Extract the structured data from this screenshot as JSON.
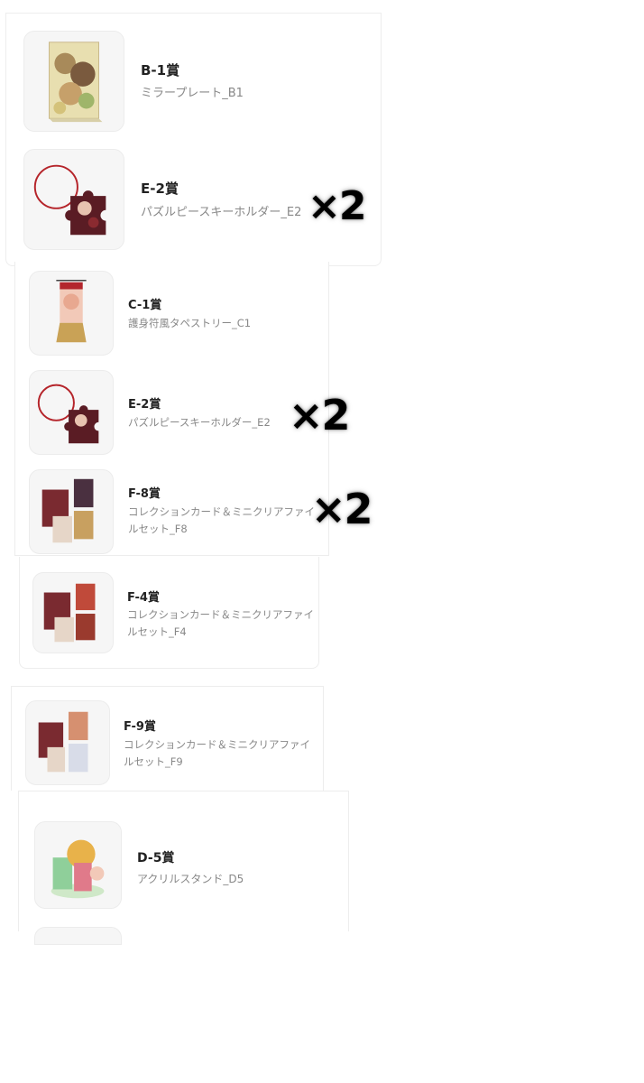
{
  "screenshots": [
    {
      "items": [
        {
          "title": "B-1賞",
          "subtitle": "ミラープレート_B1",
          "image": "mirror-plate-image"
        },
        {
          "title": "E-2賞",
          "subtitle": "パズルピースキーホルダー_E2",
          "image": "puzzle-keychain-image",
          "multiplier": "×2"
        }
      ]
    },
    {
      "items": [
        {
          "title": "C-1賞",
          "subtitle": "護身符風タペストリー_C1",
          "image": "tapestry-image"
        },
        {
          "title": "E-2賞",
          "subtitle": "パズルピースキーホルダー_E2",
          "image": "puzzle-keychain-image",
          "multiplier": "×2"
        },
        {
          "title": "F-8賞",
          "subtitle_line1": "コレクションカード＆ミニクリアファイ",
          "subtitle_line2": "ルセット_F8",
          "image": "card-file-set-image",
          "multiplier": "×2"
        }
      ]
    },
    {
      "items": [
        {
          "title": "F-4賞",
          "subtitle_line1": "コレクションカード＆ミニクリアファイ",
          "subtitle_line2": "ルセット_F4",
          "image": "card-file-set-image"
        }
      ]
    },
    {
      "items": [
        {
          "title": "F-9賞",
          "subtitle_line1": "コレクションカード＆ミニクリアファイ",
          "subtitle_line2": "ルセット_F9",
          "image": "card-file-set-image"
        }
      ]
    },
    {
      "items": [
        {
          "title": "D-5賞",
          "subtitle": "アクリルスタンド_D5",
          "image": "acrylic-stand-image"
        }
      ]
    }
  ]
}
